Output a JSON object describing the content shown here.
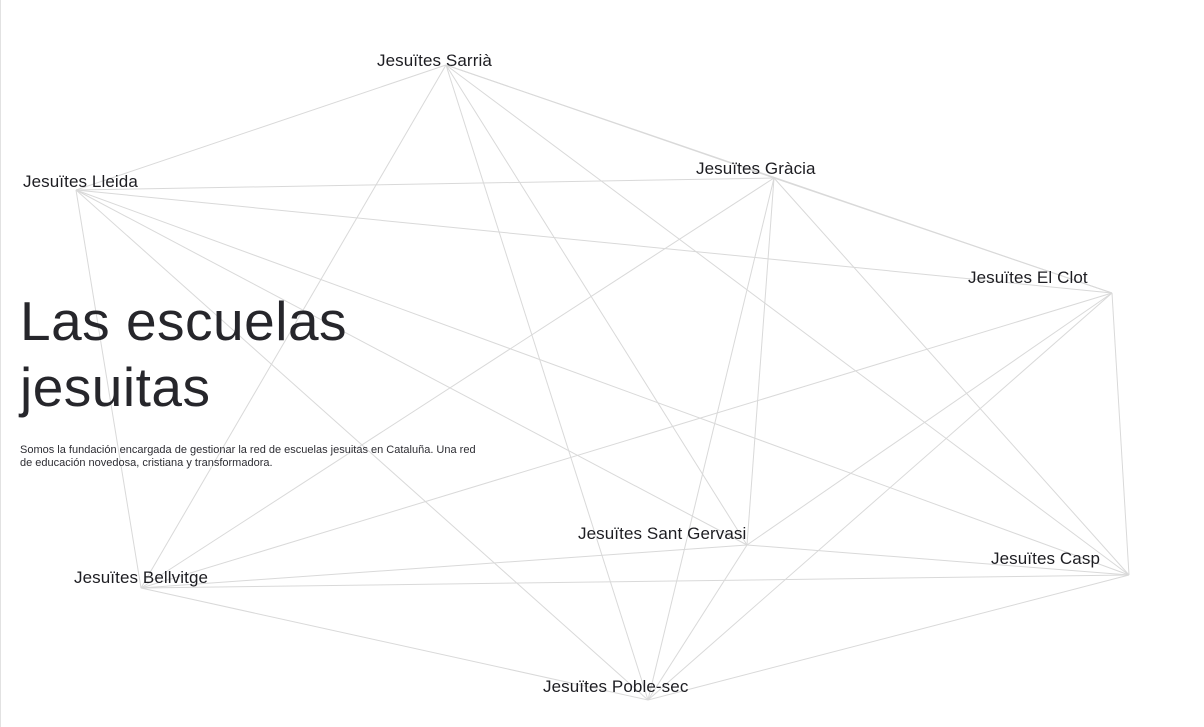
{
  "hero": {
    "title": "Las escuelas jesuitas",
    "description": "Somos la fundación encargada de gestionar la red de escuelas jesuitas en Cataluña. Una red de educación novedosa, cristiana y transformadora."
  },
  "schools": [
    {
      "id": "sarria",
      "label": "Jesuïtes Sarrià"
    },
    {
      "id": "lleida",
      "label": "Jesuïtes Lleida"
    },
    {
      "id": "gracia",
      "label": "Jesuïtes Gràcia"
    },
    {
      "id": "clot",
      "label": "Jesuïtes El Clot"
    },
    {
      "id": "santgervasi",
      "label": "Jesuïtes Sant Gervasi"
    },
    {
      "id": "casp",
      "label": "Jesuïtes Casp"
    },
    {
      "id": "bellvitge",
      "label": "Jesuïtes Bellvitge"
    },
    {
      "id": "poblesec",
      "label": "Jesuïtes Poble-sec"
    }
  ],
  "colors": {
    "connector": "#d9d9d9",
    "text": "#1d1d22"
  }
}
